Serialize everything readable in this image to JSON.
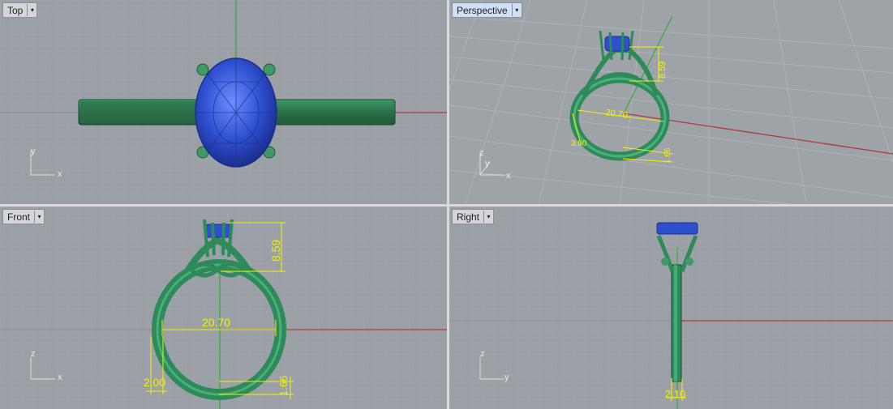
{
  "viewports": {
    "top": {
      "label": "Top",
      "axes": [
        "y",
        "x"
      ]
    },
    "perspective": {
      "label": "Perspective",
      "axes": [
        "z",
        "y",
        "x"
      ],
      "dims": {
        "height": "8.59",
        "inner": "20.70",
        "left": "3.00",
        "bottom": "1.66"
      }
    },
    "front": {
      "label": "Front",
      "axes": [
        "z",
        "x"
      ],
      "dims": {
        "height": "8.59",
        "inner": "20.70",
        "left": "2.00",
        "bottom": "1.66"
      }
    },
    "right": {
      "label": "Right",
      "axes": [
        "z",
        "y"
      ],
      "dims": {
        "bottom": "2.10"
      }
    }
  },
  "dropdown_glyph": "▾",
  "colors": {
    "grid": "#a2a8ae",
    "grid_major": "#8d9399",
    "metal": "#2f8a5a",
    "metal_light": "#4fbf83",
    "stone": "#2e4fcf",
    "dimension": "#f2f200",
    "x_axis": "#b03a3a",
    "y_axis": "#3aa83a"
  }
}
